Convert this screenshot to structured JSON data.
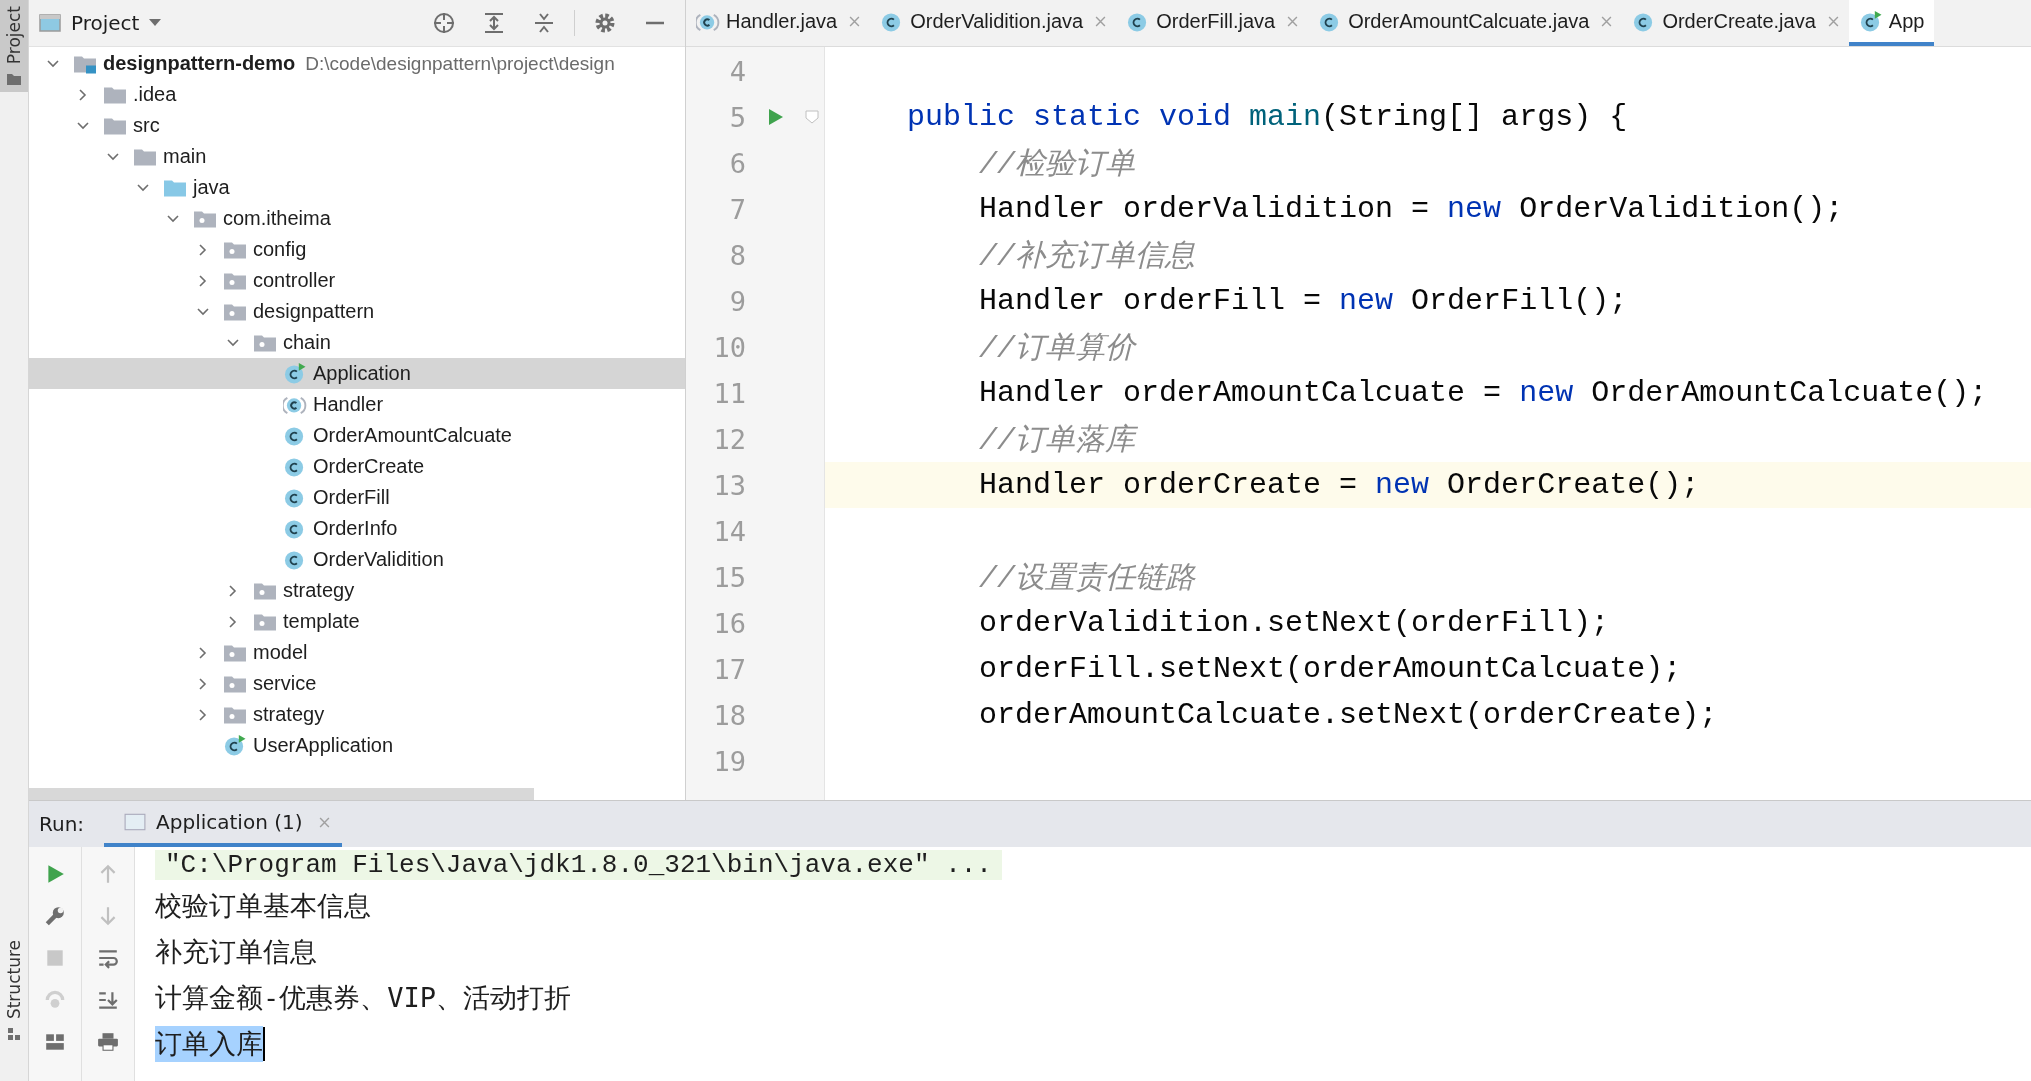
{
  "side_strip": {
    "top_tab": {
      "label": "Project",
      "selected": true
    },
    "bottom_tab": {
      "label": "Structure",
      "selected": false
    }
  },
  "project_panel": {
    "title": "Project",
    "tree": [
      {
        "label": "designpattern-demo",
        "path": "D:\\code\\designpattern\\project\\design",
        "kind": "module",
        "expanded": true,
        "selected": false,
        "children": [
          {
            "label": ".idea",
            "kind": "folder",
            "expanded": false,
            "selected": false
          },
          {
            "label": "src",
            "kind": "folder",
            "expanded": true,
            "selected": false,
            "children": [
              {
                "label": "main",
                "kind": "folder",
                "expanded": true,
                "selected": false,
                "children": [
                  {
                    "label": "java",
                    "kind": "source",
                    "expanded": true,
                    "selected": false,
                    "children": [
                      {
                        "label": "com.itheima",
                        "kind": "package",
                        "expanded": true,
                        "selected": false,
                        "children": [
                          {
                            "label": "config",
                            "kind": "package",
                            "expanded": false,
                            "selected": false
                          },
                          {
                            "label": "controller",
                            "kind": "package",
                            "expanded": false,
                            "selected": false
                          },
                          {
                            "label": "designpattern",
                            "kind": "package",
                            "expanded": true,
                            "selected": false,
                            "children": [
                              {
                                "label": "chain",
                                "kind": "package",
                                "expanded": true,
                                "selected": false,
                                "children": [
                                  {
                                    "label": "Application",
                                    "kind": "run-class",
                                    "selected": true
                                  },
                                  {
                                    "label": "Handler",
                                    "kind": "abstract-class",
                                    "selected": false
                                  },
                                  {
                                    "label": "OrderAmountCalcuate",
                                    "kind": "class",
                                    "selected": false
                                  },
                                  {
                                    "label": "OrderCreate",
                                    "kind": "class",
                                    "selected": false
                                  },
                                  {
                                    "label": "OrderFill",
                                    "kind": "class",
                                    "selected": false
                                  },
                                  {
                                    "label": "OrderInfo",
                                    "kind": "class",
                                    "selected": false
                                  },
                                  {
                                    "label": "OrderValidition",
                                    "kind": "class",
                                    "selected": false
                                  }
                                ]
                              },
                              {
                                "label": "strategy",
                                "kind": "package",
                                "expanded": false,
                                "selected": false
                              },
                              {
                                "label": "template",
                                "kind": "package",
                                "expanded": false,
                                "selected": false
                              }
                            ]
                          },
                          {
                            "label": "model",
                            "kind": "package",
                            "expanded": false,
                            "selected": false
                          },
                          {
                            "label": "service",
                            "kind": "package",
                            "expanded": false,
                            "selected": false
                          },
                          {
                            "label": "strategy",
                            "kind": "package",
                            "expanded": false,
                            "selected": false
                          },
                          {
                            "label": "UserApplication",
                            "kind": "run-class",
                            "selected": false
                          }
                        ]
                      }
                    ]
                  }
                ]
              }
            ]
          }
        ]
      }
    ]
  },
  "editor_tabs": [
    {
      "label": "Handler.java",
      "kind": "abstract-class",
      "selected": false
    },
    {
      "label": "OrderValidition.java",
      "kind": "class",
      "selected": false
    },
    {
      "label": "OrderFill.java",
      "kind": "class",
      "selected": false
    },
    {
      "label": "OrderAmountCalcuate.java",
      "kind": "class",
      "selected": false
    },
    {
      "label": "OrderCreate.java",
      "kind": "class",
      "selected": false
    },
    {
      "label": "App",
      "kind": "run-class",
      "selected": true
    }
  ],
  "editor": {
    "lines": [
      {
        "number": "4",
        "current": false,
        "run_marker": false
      },
      {
        "number": "5",
        "current": false,
        "run_marker": true,
        "tokens": [
          {
            "t": "    public static void ",
            "kind": "kw"
          },
          {
            "t": "main",
            "kind": "method"
          },
          {
            "t": "(String[] args) {",
            "kind": "plain"
          }
        ]
      },
      {
        "number": "6",
        "current": false,
        "run_marker": false,
        "tokens": [
          {
            "t": "        //检验订单",
            "kind": "comment"
          }
        ]
      },
      {
        "number": "7",
        "current": false,
        "run_marker": false,
        "tokens": [
          {
            "t": "        Handler orderValidition = ",
            "kind": "plain"
          },
          {
            "t": "new",
            "kind": "kw"
          },
          {
            "t": " OrderValidition();",
            "kind": "plain"
          }
        ]
      },
      {
        "number": "8",
        "current": false,
        "run_marker": false,
        "tokens": [
          {
            "t": "        //补充订单信息",
            "kind": "comment"
          }
        ]
      },
      {
        "number": "9",
        "current": false,
        "run_marker": false,
        "tokens": [
          {
            "t": "        Handler orderFill = ",
            "kind": "plain"
          },
          {
            "t": "new",
            "kind": "kw"
          },
          {
            "t": " OrderFill();",
            "kind": "plain"
          }
        ]
      },
      {
        "number": "10",
        "current": false,
        "run_marker": false,
        "tokens": [
          {
            "t": "        //订单算价",
            "kind": "comment"
          }
        ]
      },
      {
        "number": "11",
        "current": false,
        "run_marker": false,
        "tokens": [
          {
            "t": "        Handler orderAmountCalcuate = ",
            "kind": "plain"
          },
          {
            "t": "new",
            "kind": "kw"
          },
          {
            "t": " OrderAmountCalcuate();",
            "kind": "plain"
          }
        ]
      },
      {
        "number": "12",
        "current": false,
        "run_marker": false,
        "tokens": [
          {
            "t": "        //订单落库",
            "kind": "comment"
          }
        ]
      },
      {
        "number": "13",
        "current": true,
        "run_marker": false,
        "tokens": [
          {
            "t": "        Handler orderCreate = ",
            "kind": "plain"
          },
          {
            "t": "new",
            "kind": "kw"
          },
          {
            "t": " OrderCreate();",
            "kind": "plain"
          }
        ]
      },
      {
        "number": "14",
        "current": false,
        "run_marker": false
      },
      {
        "number": "15",
        "current": false,
        "run_marker": false,
        "tokens": [
          {
            "t": "        //设置责任链路",
            "kind": "comment"
          }
        ]
      },
      {
        "number": "16",
        "current": false,
        "run_marker": false,
        "tokens": [
          {
            "t": "        orderValidition.setNext(orderFill);",
            "kind": "plain"
          }
        ]
      },
      {
        "number": "17",
        "current": false,
        "run_marker": false,
        "tokens": [
          {
            "t": "        orderFill.setNext(orderAmountCalcuate);",
            "kind": "plain"
          }
        ]
      },
      {
        "number": "18",
        "current": false,
        "run_marker": false,
        "tokens": [
          {
            "t": "        orderAmountCalcuate.setNext(orderCreate);",
            "kind": "plain"
          }
        ]
      },
      {
        "number": "19",
        "current": false,
        "run_marker": false
      }
    ]
  },
  "run_panel": {
    "label": "Run:",
    "tabs": [
      {
        "label": "Application (1)",
        "selected": true
      }
    ],
    "output": [
      {
        "text": "\"C:\\Program Files\\Java\\jdk1.8.0_321\\bin\\java.exe\" ...",
        "kind": "command"
      },
      {
        "text": "校验订单基本信息",
        "kind": "stdout",
        "selected": false
      },
      {
        "text": "补充订单信息",
        "kind": "stdout",
        "selected": false
      },
      {
        "text": "计算金额-优惠券、VIP、活动打折",
        "kind": "stdout",
        "selected": false
      },
      {
        "text": "订单入库",
        "kind": "stdout",
        "selected": true
      }
    ]
  }
}
